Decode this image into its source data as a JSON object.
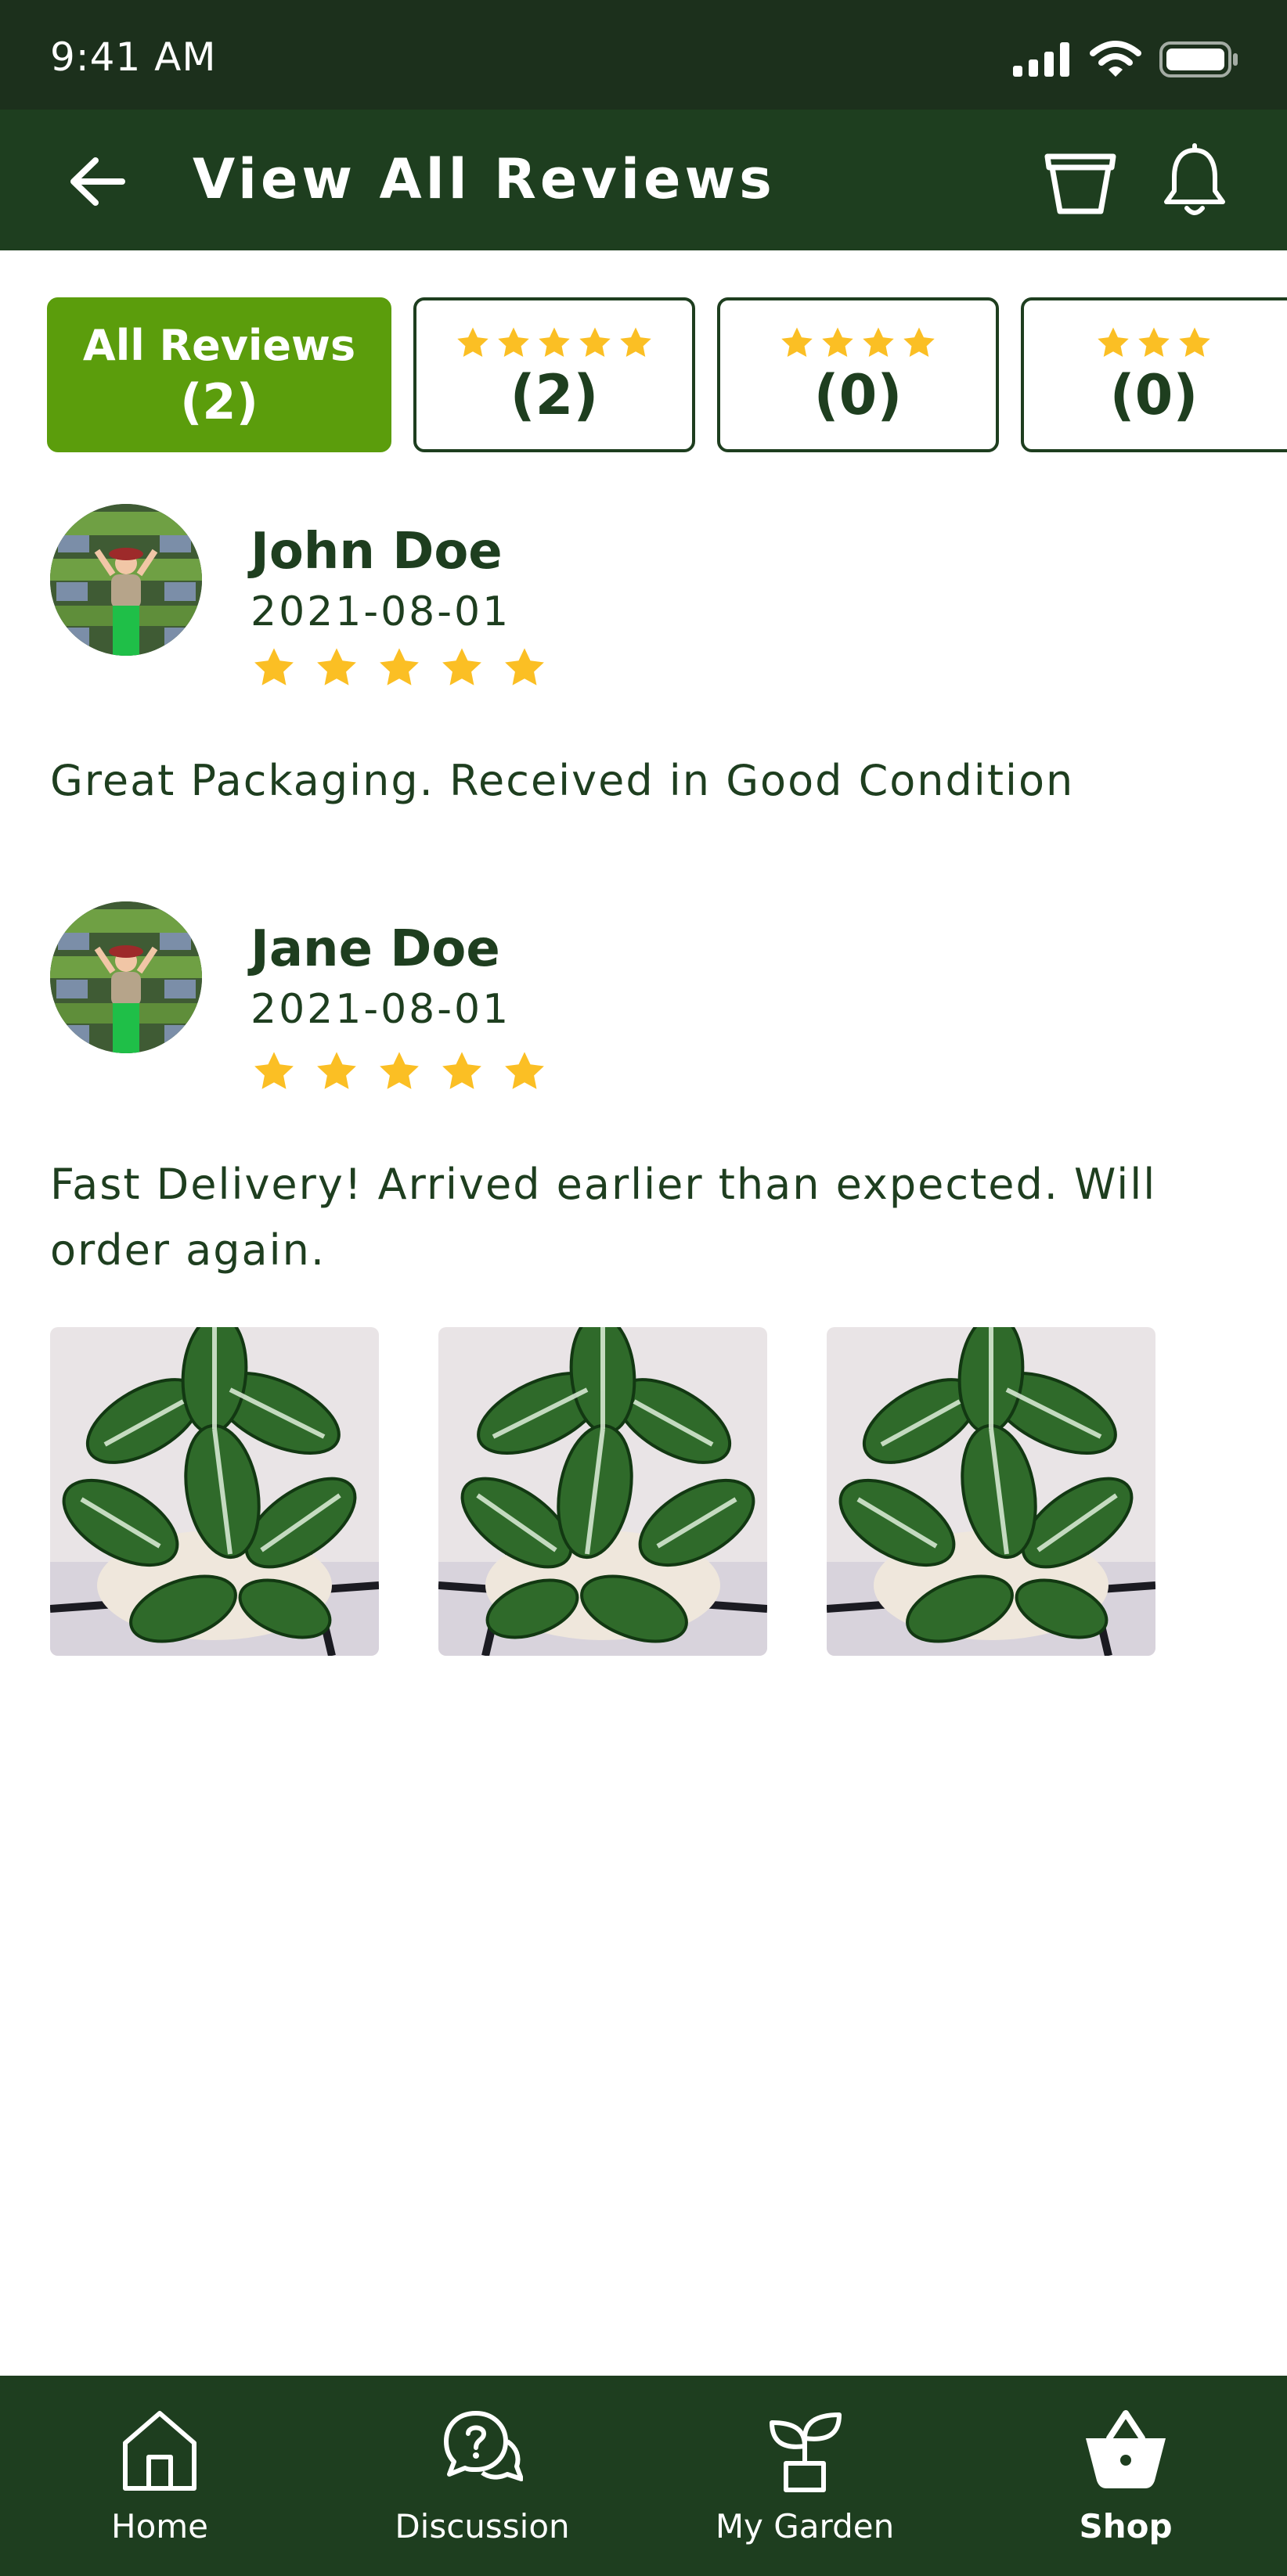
{
  "status_bar": {
    "time": "9:41 AM"
  },
  "header": {
    "title": "View All Reviews"
  },
  "filter_tabs": [
    {
      "label": "All Reviews",
      "count": "(2)",
      "stars": 0,
      "active": true
    },
    {
      "label": "",
      "count": "(2)",
      "stars": 5,
      "active": false
    },
    {
      "label": "",
      "count": "(0)",
      "stars": 4,
      "active": false
    },
    {
      "label": "",
      "count": "(0)",
      "stars": 3,
      "active": false
    }
  ],
  "reviews": [
    {
      "name": "John Doe",
      "date": "2021-08-01",
      "rating": 5,
      "text": "Great Packaging. Received in Good Condition"
    },
    {
      "name": "Jane Doe",
      "date": "2021-08-01",
      "rating": 5,
      "text": "Fast Delivery! Arrived  earlier than expected. Will order again."
    }
  ],
  "bottom_nav": [
    {
      "label": "Home",
      "icon": "home-icon",
      "active": false
    },
    {
      "label": "Discussion",
      "icon": "discussion-icon",
      "active": false
    },
    {
      "label": "My Garden",
      "icon": "plant-icon",
      "active": false
    },
    {
      "label": "Shop",
      "icon": "shop-basket-icon",
      "active": true
    }
  ],
  "colors": {
    "header": "#1e3e1f",
    "status_bar": "#1c301c",
    "active_tab": "#5b9d0c",
    "star": "#fbbf24",
    "text": "#1e3e1f"
  }
}
